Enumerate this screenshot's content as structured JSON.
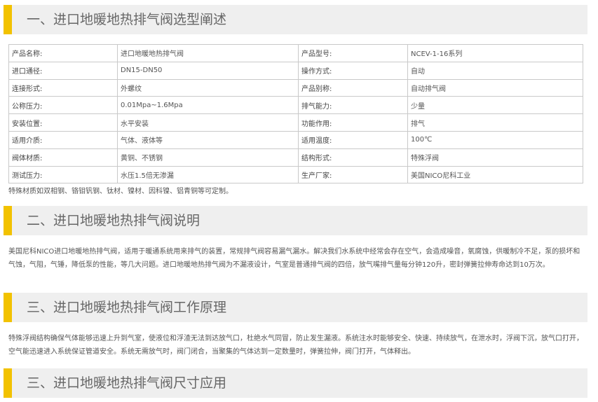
{
  "sections": [
    {
      "title": "一、进口地暖地热排气阀选型阐述"
    },
    {
      "title": "二、进口地暖地热排气阀说明"
    },
    {
      "title": "三、进口地暖地热排气阀工作原理"
    },
    {
      "title": "三、进口地暖地热排气阀尺寸应用"
    }
  ],
  "spec_table": {
    "rows": [
      [
        "产品名称:",
        "进口地暖地热排气阀",
        "产品型号:",
        "NCEV-1-16系列"
      ],
      [
        "进口通径:",
        "DN15-DN50",
        "操作方式:",
        "自动"
      ],
      [
        "连接形式:",
        "外螺纹",
        "产品别称:",
        "自动排气阀"
      ],
      [
        "公称压力:",
        "0.01Mpa~1.6Mpa",
        "排气能力:",
        "少量"
      ],
      [
        "安装位置:",
        "水平安装",
        "功能作用:",
        "排气"
      ],
      [
        "适用介质:",
        "气体、液体等",
        "适用温度:",
        "100℃"
      ],
      [
        "阀体材质:",
        "黄铜、不锈钢",
        "结构形式:",
        "特殊浮阀"
      ],
      [
        "测试压力:",
        "水压1.5倍无渗漏",
        "生产厂家:",
        "美国NICO尼科工业"
      ]
    ]
  },
  "material_note": "特殊材质如双相钢、铬钼钒钢、钛材、镍材、因科镍、铝青铜等可定制。",
  "description": "美国尼科NICO进口地暖地热排气阀，适用于暖通系统用来排气的装置，常规排气阀容易漏气漏水。解决我们水系统中经常会存在空气，会造成噪音，氧腐蚀，供暖制冷不足，泵的损坏和气蚀，气阻，气锤，降低泵的性能，等几大问题。进口地暖地热排气阀为不漏液设计，气室是普通排气阀的四倍，放气嘴排气量每分钟120升，密封弹簧拉伸寿命达到10万次。",
  "working_principle": "特殊浮阀结构确保气体能够迅速上升到气室，使液位和浮渣无法到达放气口，杜绝水气同冒，防止发生漏液。系统注水时能够安全、快速、持续放气，在泄水时，浮阀下沉，放气口打开，空气能迅速进入系统保证管道安全。系统无需放气时，阀门闭合，当聚集的气体达到一定数量时，弹簧拉伸，阀门打开，气体释出。",
  "colors": {
    "accent_bar": "#f2c200",
    "header_bg": "#efefef",
    "table_border": "#c9c9c9"
  }
}
